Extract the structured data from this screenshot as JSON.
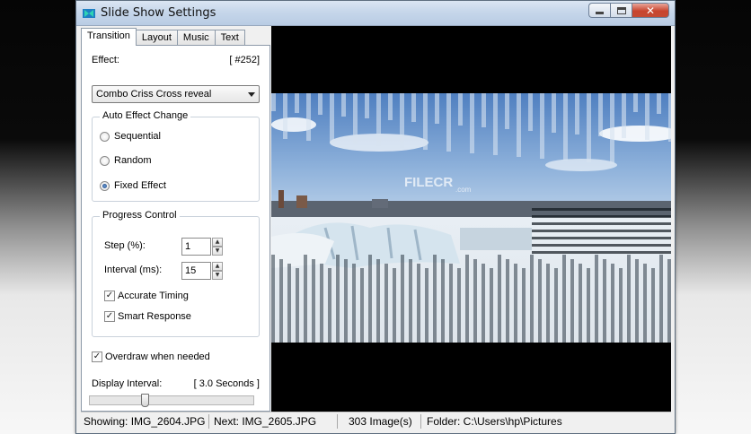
{
  "window": {
    "title": "Slide Show Settings"
  },
  "tabs": [
    "Transition",
    "Layout",
    "Music",
    "Text"
  ],
  "effect": {
    "label": "Effect:",
    "number": "[ #252]",
    "selected": "Combo Criss Cross reveal"
  },
  "auto_effect": {
    "title": "Auto Effect Change",
    "options": [
      "Sequential",
      "Random",
      "Fixed Effect"
    ],
    "selected": "Fixed Effect"
  },
  "progress": {
    "title": "Progress Control",
    "step_label": "Step (%):",
    "step_value": "1",
    "interval_label": "Interval (ms):",
    "interval_value": "15",
    "accurate_timing": "Accurate Timing",
    "smart_response": "Smart Response"
  },
  "overdraw": "Overdraw when needed",
  "display_interval": {
    "label": "Display Interval:",
    "value": "[ 3.0 Seconds ]"
  },
  "watermark": {
    "brand": "FILECR",
    "suffix": ".com"
  },
  "status": {
    "showing": "Showing: IMG_2604.JPG",
    "next": "Next: IMG_2605.JPG",
    "count": "303 Image(s)",
    "folder": "Folder: C:\\Users\\hp\\Pictures"
  },
  "colors": {
    "sky": "#7fa6d4",
    "snow": "#e9eef3",
    "accent": "#1c3f7a"
  }
}
